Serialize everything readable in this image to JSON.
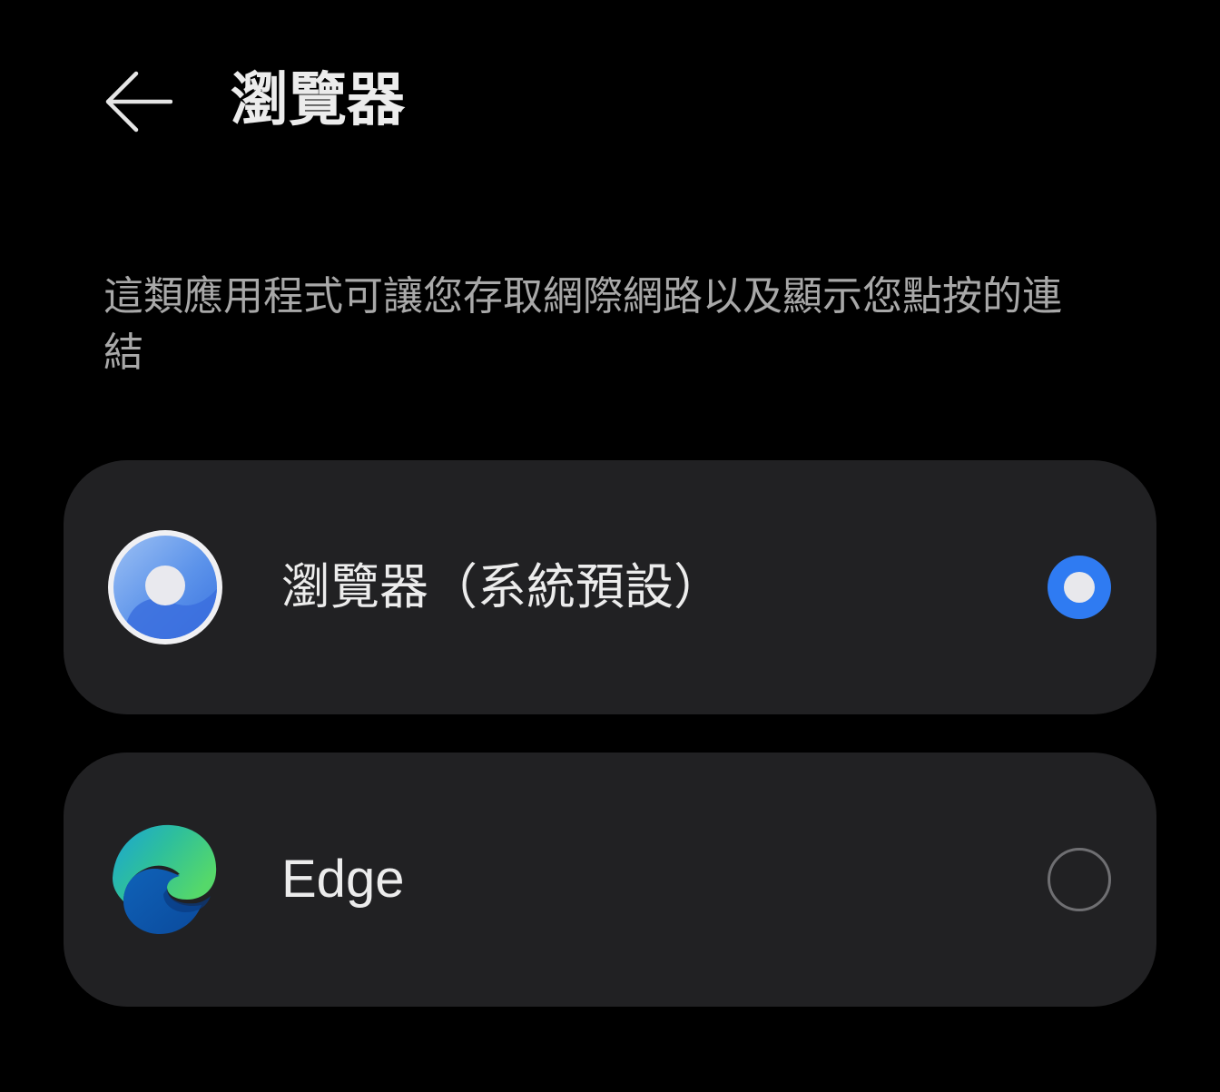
{
  "header": {
    "back_icon": "arrow-left-icon",
    "title": "瀏覽器"
  },
  "description": "這類應用程式可讓您存取網際網路以及顯示您點按的連結",
  "options": [
    {
      "label": "瀏覽器（系統預設）",
      "icon": "system-browser-icon",
      "selected": true
    },
    {
      "label": "Edge",
      "icon": "edge-browser-icon",
      "selected": false
    }
  ],
  "colors": {
    "background": "#000000",
    "card": "#212123",
    "accent": "#2f7bf2",
    "text_primary": "#ececec",
    "text_secondary": "#a8a8a8"
  }
}
